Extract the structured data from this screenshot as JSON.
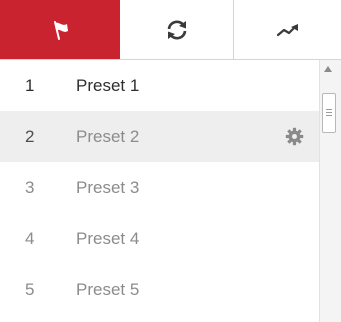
{
  "tabs": [
    {
      "icon": "flag-icon",
      "active": true
    },
    {
      "icon": "patrol-refresh-icon",
      "active": false
    },
    {
      "icon": "pattern-trend-icon",
      "active": false
    }
  ],
  "accent_color": "#c9232f",
  "presets": [
    {
      "number": "1",
      "name": "Preset 1"
    },
    {
      "number": "2",
      "name": "Preset 2"
    },
    {
      "number": "3",
      "name": "Preset 3"
    },
    {
      "number": "4",
      "name": "Preset 4"
    },
    {
      "number": "5",
      "name": "Preset 5"
    }
  ]
}
